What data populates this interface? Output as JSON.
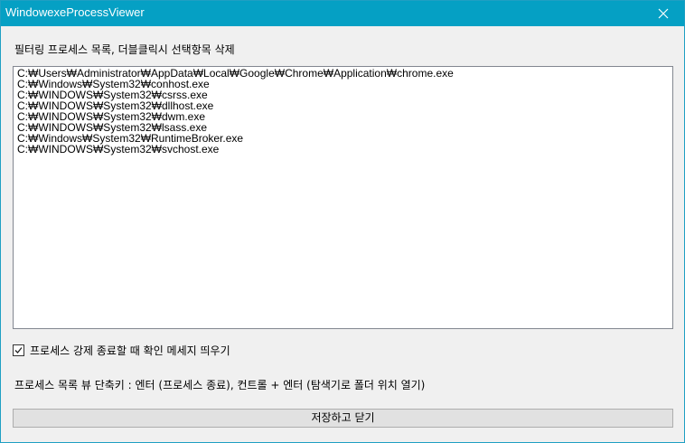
{
  "window": {
    "title": "WindowexeProcessViewer"
  },
  "description_label": "필터링 프로세스 목록, 더블클릭시 선택항목 삭제",
  "process_list": [
    "C:₩Users₩Administrator₩AppData₩Local₩Google₩Chrome₩Application₩chrome.exe",
    "C:₩Windows₩System32₩conhost.exe",
    "C:₩WINDOWS₩System32₩csrss.exe",
    "C:₩WINDOWS₩System32₩dllhost.exe",
    "C:₩WINDOWS₩System32₩dwm.exe",
    "C:₩WINDOWS₩System32₩lsass.exe",
    "C:₩Windows₩System32₩RuntimeBroker.exe",
    "C:₩WINDOWS₩System32₩svchost.exe"
  ],
  "confirm_checkbox": {
    "label": "프로세스 강제 종료할 때 확인 메세지 띄우기",
    "checked": true
  },
  "shortcut_label": "프로세스 목록 뷰 단축키 : 엔터 (프로세스 종료), 컨트롤 + 엔터 (탐색기로 폴더 위치 열기)",
  "save_button_label": "저장하고 닫기",
  "colors": {
    "titlebar": "#05a0c4",
    "window_bg": "#f0f0f0",
    "button_bg": "#e1e1e1"
  },
  "icons": {
    "close": "close-icon",
    "check": "checkmark-icon"
  }
}
